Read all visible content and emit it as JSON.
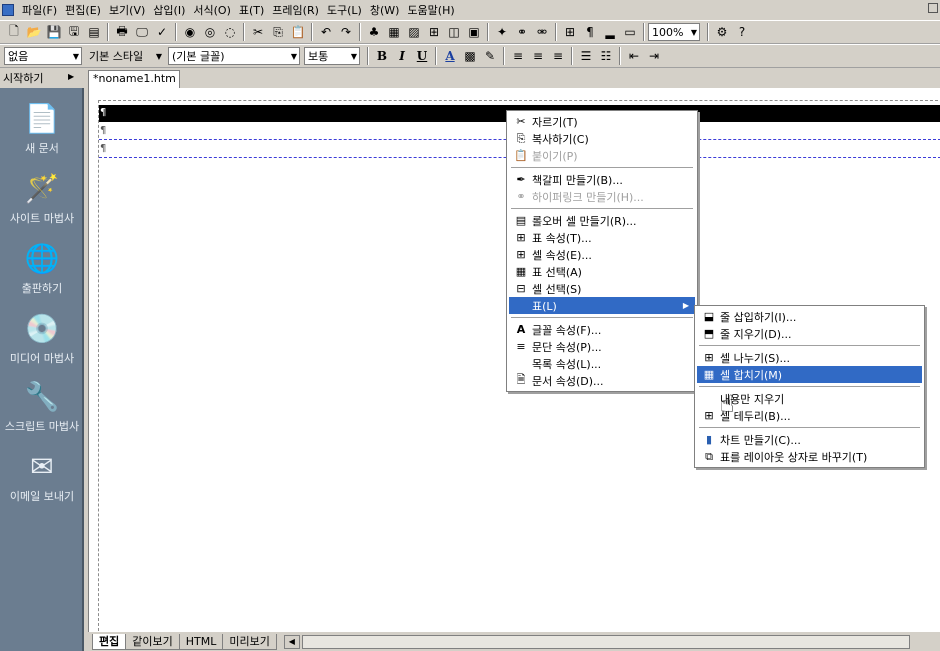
{
  "menubar": {
    "items": [
      "파일(F)",
      "편집(E)",
      "보기(V)",
      "삽입(I)",
      "서식(O)",
      "표(T)",
      "프레임(R)",
      "도구(L)",
      "창(W)",
      "도움말(H)"
    ]
  },
  "toolbar2": {
    "style_combo": "없음",
    "para_combo": "기본 스타일",
    "font_combo": "(기본 글꼴)",
    "size_combo": "보통",
    "zoom_combo": "100%",
    "bold": "B",
    "italic": "I",
    "underline": "U",
    "font_color": "A"
  },
  "tabs": {
    "start_label": "시작하기",
    "doc_tab": "*noname1.htm"
  },
  "sidebar": {
    "items": [
      {
        "label": "새 문서",
        "icon": "new-document-icon"
      },
      {
        "label": "사이트 마법사",
        "icon": "site-wizard-icon"
      },
      {
        "label": "출판하기",
        "icon": "publish-icon"
      },
      {
        "label": "미디어 마법사",
        "icon": "media-wizard-icon"
      },
      {
        "label": "스크립트 마법사",
        "icon": "script-wizard-icon"
      },
      {
        "label": "이메일 보내기",
        "icon": "email-icon"
      }
    ]
  },
  "bottom_tabs": [
    "편집",
    "같이보기",
    "HTML",
    "미리보기"
  ],
  "context_menu": {
    "cut": "자르기(T)",
    "copy": "복사하기(C)",
    "paste": "붙이기(P)",
    "bookmark": "책갈피 만들기(B)...",
    "hyperlink": "하이퍼링크 만들기(H)...",
    "rollover": "롤오버 셀 만들기(R)...",
    "table_props": "표 속성(T)...",
    "cell_props": "셀 속성(E)...",
    "select_table": "표 선택(A)",
    "select_cell": "셀 선택(S)",
    "table_menu": "표(L)",
    "font_props": "글꼴 속성(F)...",
    "para_props": "문단 속성(P)...",
    "list_props": "목록 속성(L)...",
    "doc_props": "문서 속성(D)..."
  },
  "submenu": {
    "insert_row": "줄 삽입하기(I)...",
    "delete_row": "줄 지우기(D)...",
    "split_cell": "셀 나누기(S)...",
    "merge_cell": "셀 합치기(M)",
    "clear_content": "내용만 지우기",
    "cell_border": "셀 테두리(B)...",
    "make_chart": "차트 만들기(C)...",
    "to_layout": "표를 레이아웃 상자로 바꾸기(T)"
  },
  "colors": {
    "highlight": "#316ac5",
    "sidebar": "#6b7d90"
  }
}
